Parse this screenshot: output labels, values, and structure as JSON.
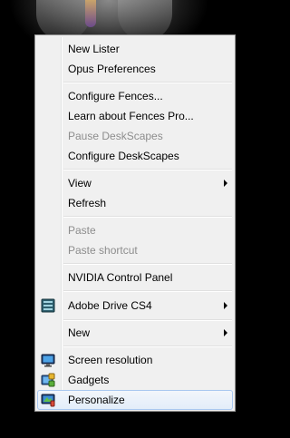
{
  "menu": {
    "items": [
      {
        "label": "New Lister"
      },
      {
        "label": "Opus Preferences"
      },
      {
        "label": "Configure Fences..."
      },
      {
        "label": "Learn about Fences Pro..."
      },
      {
        "label": "Pause DeskScapes"
      },
      {
        "label": "Configure DeskScapes"
      },
      {
        "label": "View"
      },
      {
        "label": "Refresh"
      },
      {
        "label": "Paste"
      },
      {
        "label": "Paste shortcut"
      },
      {
        "label": "NVIDIA Control Panel"
      },
      {
        "label": "Adobe Drive CS4"
      },
      {
        "label": "New"
      },
      {
        "label": "Screen resolution"
      },
      {
        "label": "Gadgets"
      },
      {
        "label": "Personalize"
      }
    ]
  }
}
